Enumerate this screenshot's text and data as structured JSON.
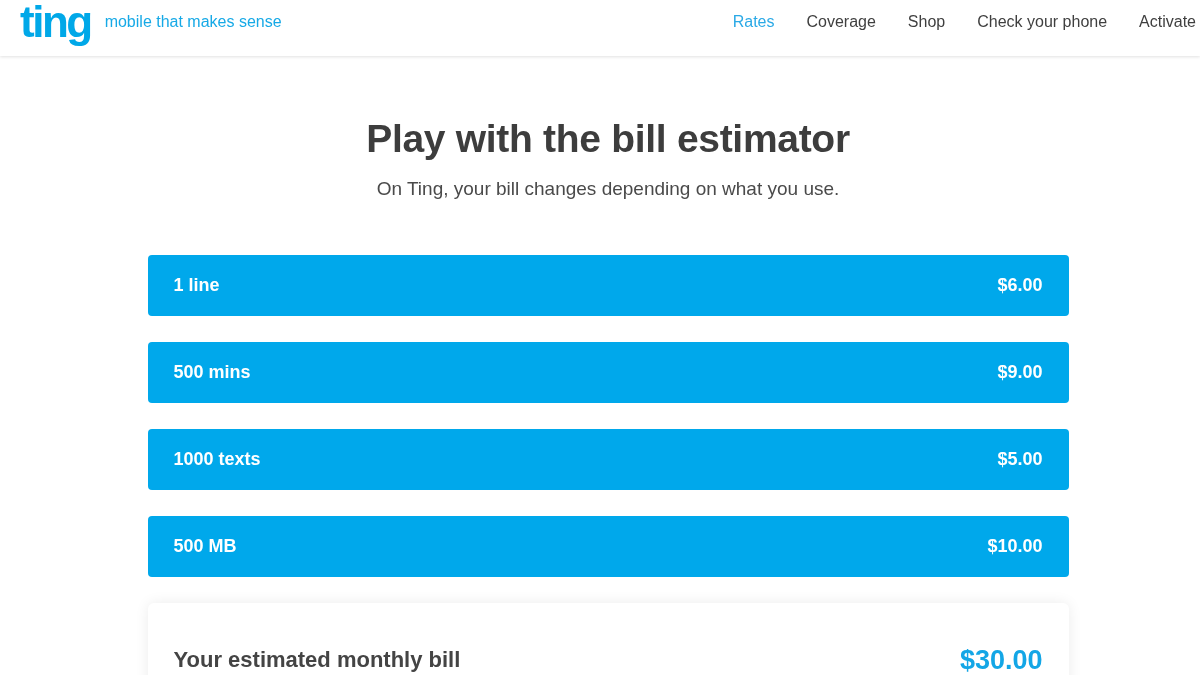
{
  "header": {
    "logo": "ting",
    "tagline": "mobile that makes sense",
    "nav": [
      {
        "label": "Rates",
        "selected": true
      },
      {
        "label": "Coverage",
        "selected": false
      },
      {
        "label": "Shop",
        "selected": false
      },
      {
        "label": "Check your phone",
        "selected": false
      },
      {
        "label": "Activate",
        "selected": false
      }
    ]
  },
  "intro": {
    "title": "Play with the bill estimator",
    "subtitle": "On Ting, your bill changes depending on what you use."
  },
  "estimator": [
    {
      "label": "1 line",
      "price": "$6.00"
    },
    {
      "label": "500 mins",
      "price": "$9.00"
    },
    {
      "label": "1000 texts",
      "price": "$5.00"
    },
    {
      "label": "500 MB",
      "price": "$10.00"
    }
  ],
  "total": {
    "label": "Your estimated monthly bill",
    "amount": "$30.00"
  }
}
